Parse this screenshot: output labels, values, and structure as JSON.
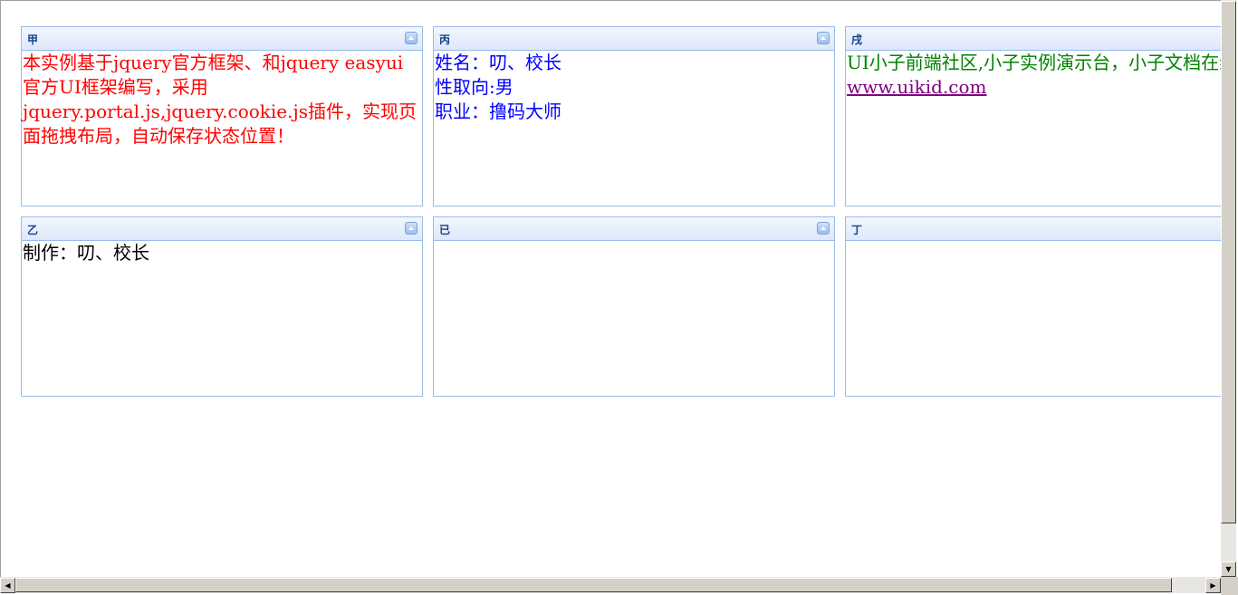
{
  "panels": {
    "jia": {
      "title": "甲",
      "lines": [
        "本实例基于jquery官方框架、和jquery easyui官方UI框架编写，采用jquery.portal.js,jquery.cookie.js插件，实现页面拖拽布局，自动保存状态位置！"
      ]
    },
    "bing": {
      "title": "丙",
      "lines": [
        "姓名：叨、校长",
        "性取向:男",
        "职业：撸码大师"
      ]
    },
    "wu": {
      "title": "戌",
      "text": "UI小子前端社区,小子实例演示台，小子文档在线",
      "link": "www.uikid.com"
    },
    "yi": {
      "title": "乙",
      "text": "制作：叨、校长"
    },
    "ji": {
      "title": "已"
    },
    "ding": {
      "title": "丁"
    }
  },
  "scrollbars": {
    "up": "▲",
    "down": "▼",
    "left": "◀",
    "right": "▶"
  }
}
